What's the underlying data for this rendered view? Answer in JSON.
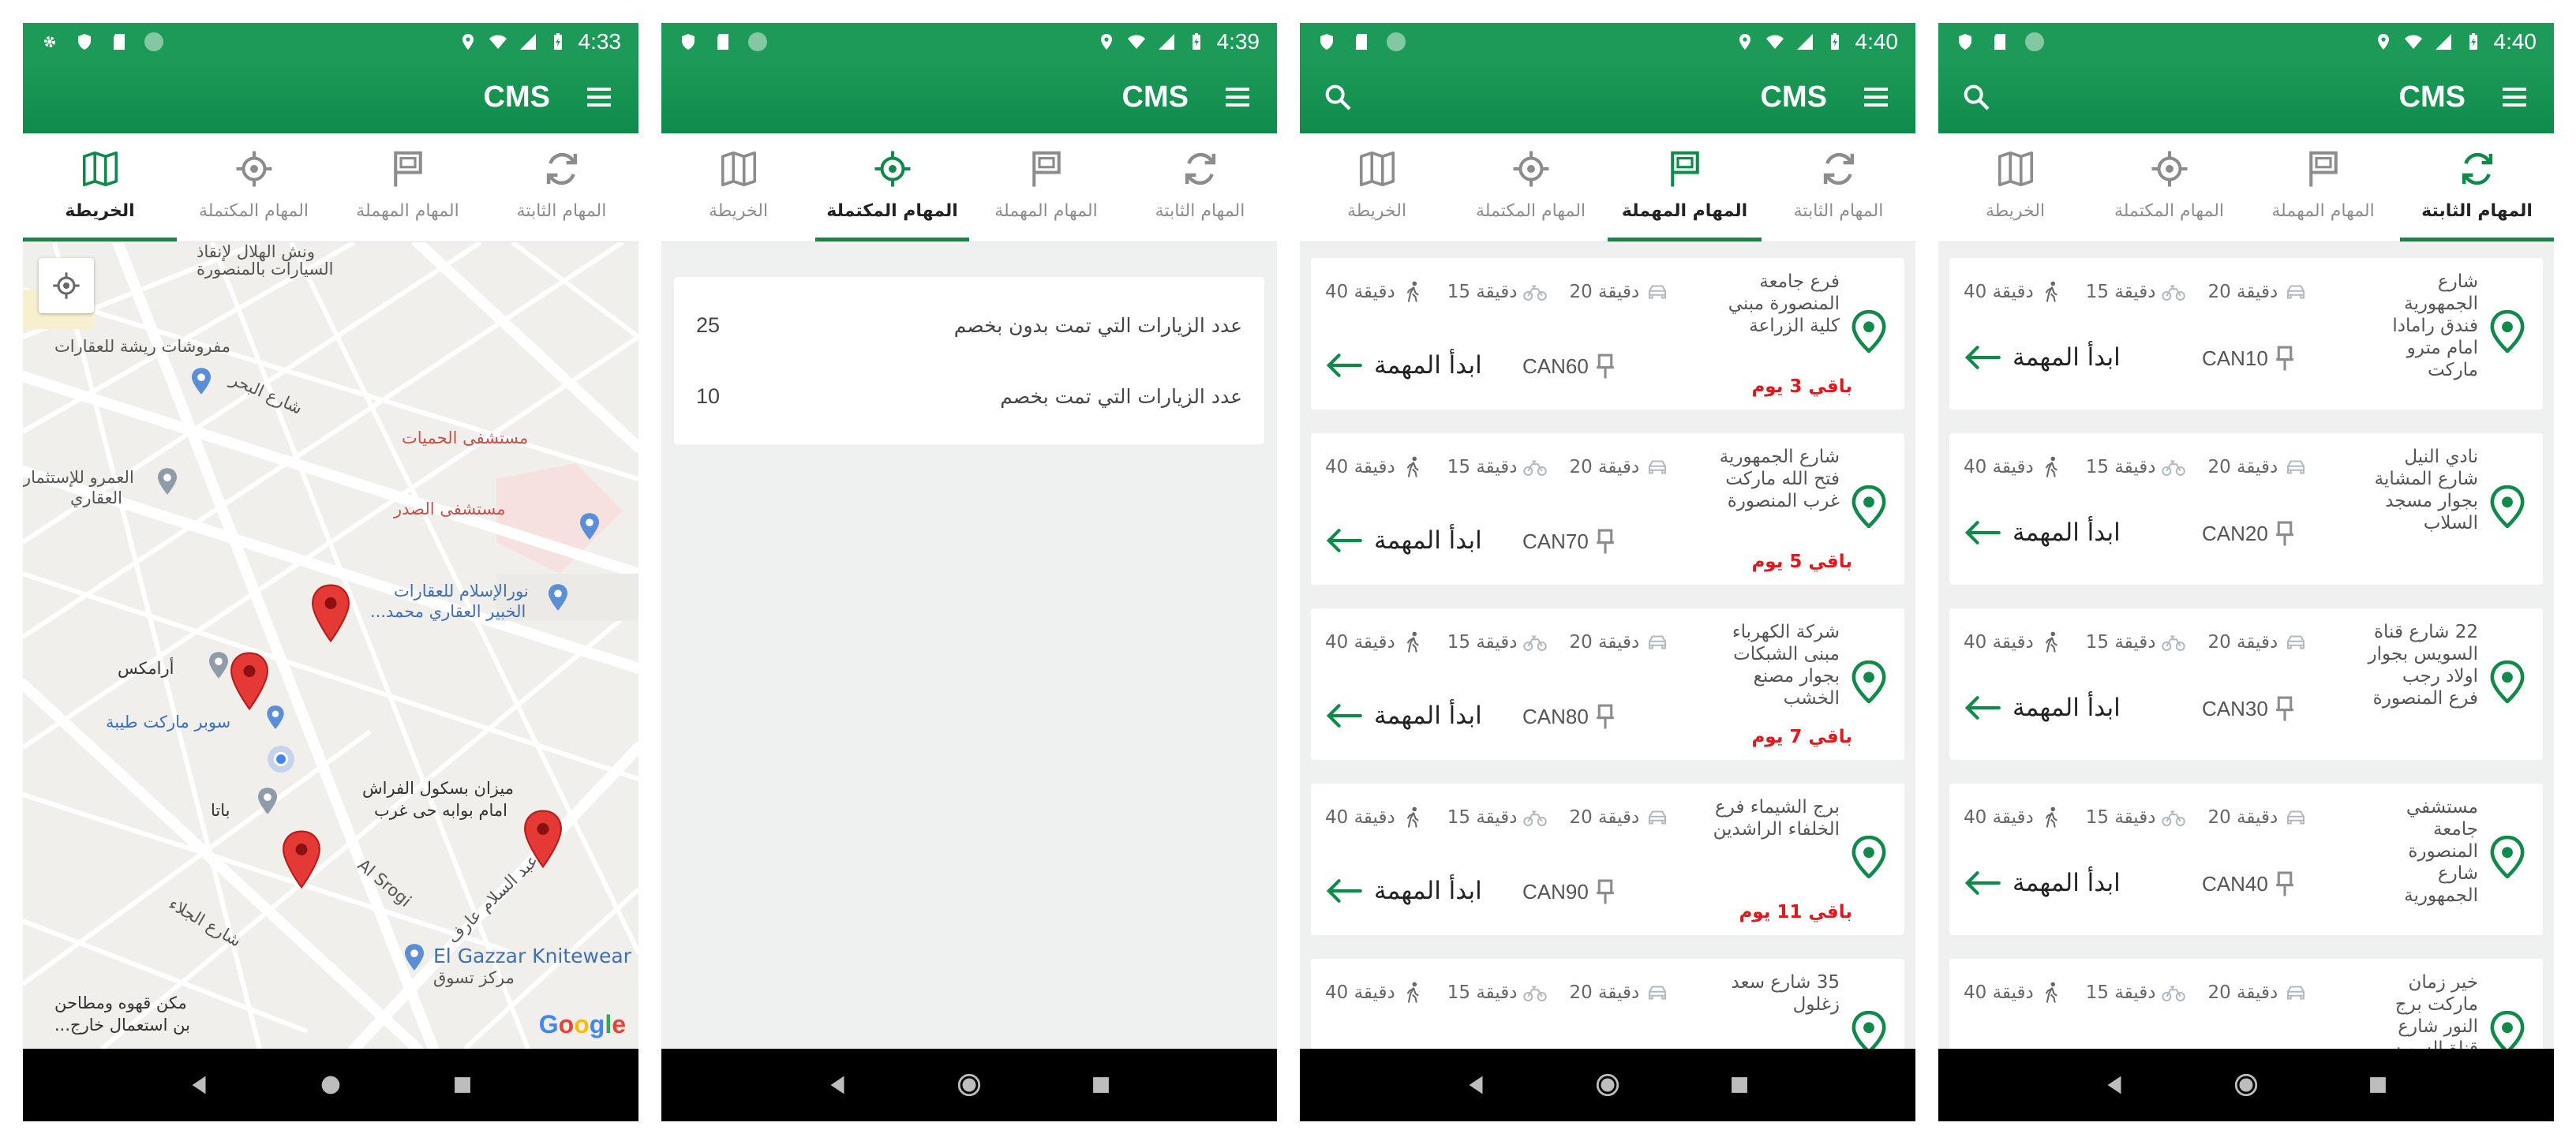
{
  "app_title": "CMS",
  "colors": {
    "primary": "#1e9a58",
    "accent": "#0f8a4b",
    "danger": "#e0191b"
  },
  "tabs": {
    "fixed": "المهام الثابتة",
    "neglected": "المهام المهملة",
    "completed": "المهام المكتملة",
    "map": "الخريطة"
  },
  "screens": [
    {
      "time": "4:33",
      "active_tab": "map"
    },
    {
      "time": "4:39",
      "active_tab": "completed"
    },
    {
      "time": "4:40",
      "active_tab": "neglected"
    },
    {
      "time": "4:40",
      "active_tab": "fixed"
    }
  ],
  "map": {
    "labels": [
      "مستشفى الحميات",
      "مستشفى الصدر",
      "نورالإسلام للعقارات",
      "الخبير العقاري محمد...",
      "العمرو للإستثمار",
      "العقاري",
      "مفروشات ريشة للعقارات",
      "أرامكس",
      "سوبر ماركت طيبة",
      "باتا",
      "ميزان بسكول الفراش",
      "امام بوابه حى غرب",
      "El Gazzar Knitewear",
      "مركز تسوق",
      "مكن قهوه ومطاحن",
      "بن استعمال خارج...",
      "ونش الهلال لإنقاذ",
      "السيارات بالمنصورة",
      "Al Srogi",
      "شارع البحر",
      "عبد السلام عارف",
      "شارع الجلاء"
    ],
    "google": "Google"
  },
  "completed": {
    "rows": [
      {
        "label": "عدد الزيارات التي تمت بدون بخصم",
        "value": "25"
      },
      {
        "label": "عدد الزيارات التي تمت بخصم",
        "value": "10"
      }
    ]
  },
  "task_common": {
    "car_time": "20 دقيقة",
    "bike_time": "15 دقيقة",
    "walk_time": "40 دقيقة",
    "start_label": "ابدأ المهمة"
  },
  "neglected_tasks": [
    {
      "address": "فرع جامعة المنصورة مبني كلية الزراعة",
      "code": "CAN60",
      "remaining": "باقي 3 يوم"
    },
    {
      "address": "شارع الجمهورية فتح الله ماركت غرب المنصورة",
      "code": "CAN70",
      "remaining": "باقي 5 يوم"
    },
    {
      "address": "شركة الكهرباء مبنى الشبكات بجوار مصنع الخشب",
      "code": "CAN80",
      "remaining": "باقي 7 يوم"
    },
    {
      "address": "برج الشيماء فرع الخلفاء الراشدين",
      "code": "CAN90",
      "remaining": "باقي 11 يوم"
    },
    {
      "address": "35 شارع سعد زغلول",
      "code": "",
      "remaining": ""
    }
  ],
  "fixed_tasks": [
    {
      "address": "شارع الجمهورية فندق رامادا امام مترو ماركت",
      "code": "CAN10"
    },
    {
      "address": "نادي النيل شارع المشاية بجوار مسجد السلاب",
      "code": "CAN20"
    },
    {
      "address": "22 شارع قناة السويس بجوار اولاد رجب فرع المنصورة",
      "code": "CAN30"
    },
    {
      "address": "مستشفي جامعة المنصورة شارع الجمهورية",
      "code": "CAN40"
    },
    {
      "address": "خير زمان ماركت برج النور شارع قناة السويس",
      "code": ""
    }
  ]
}
